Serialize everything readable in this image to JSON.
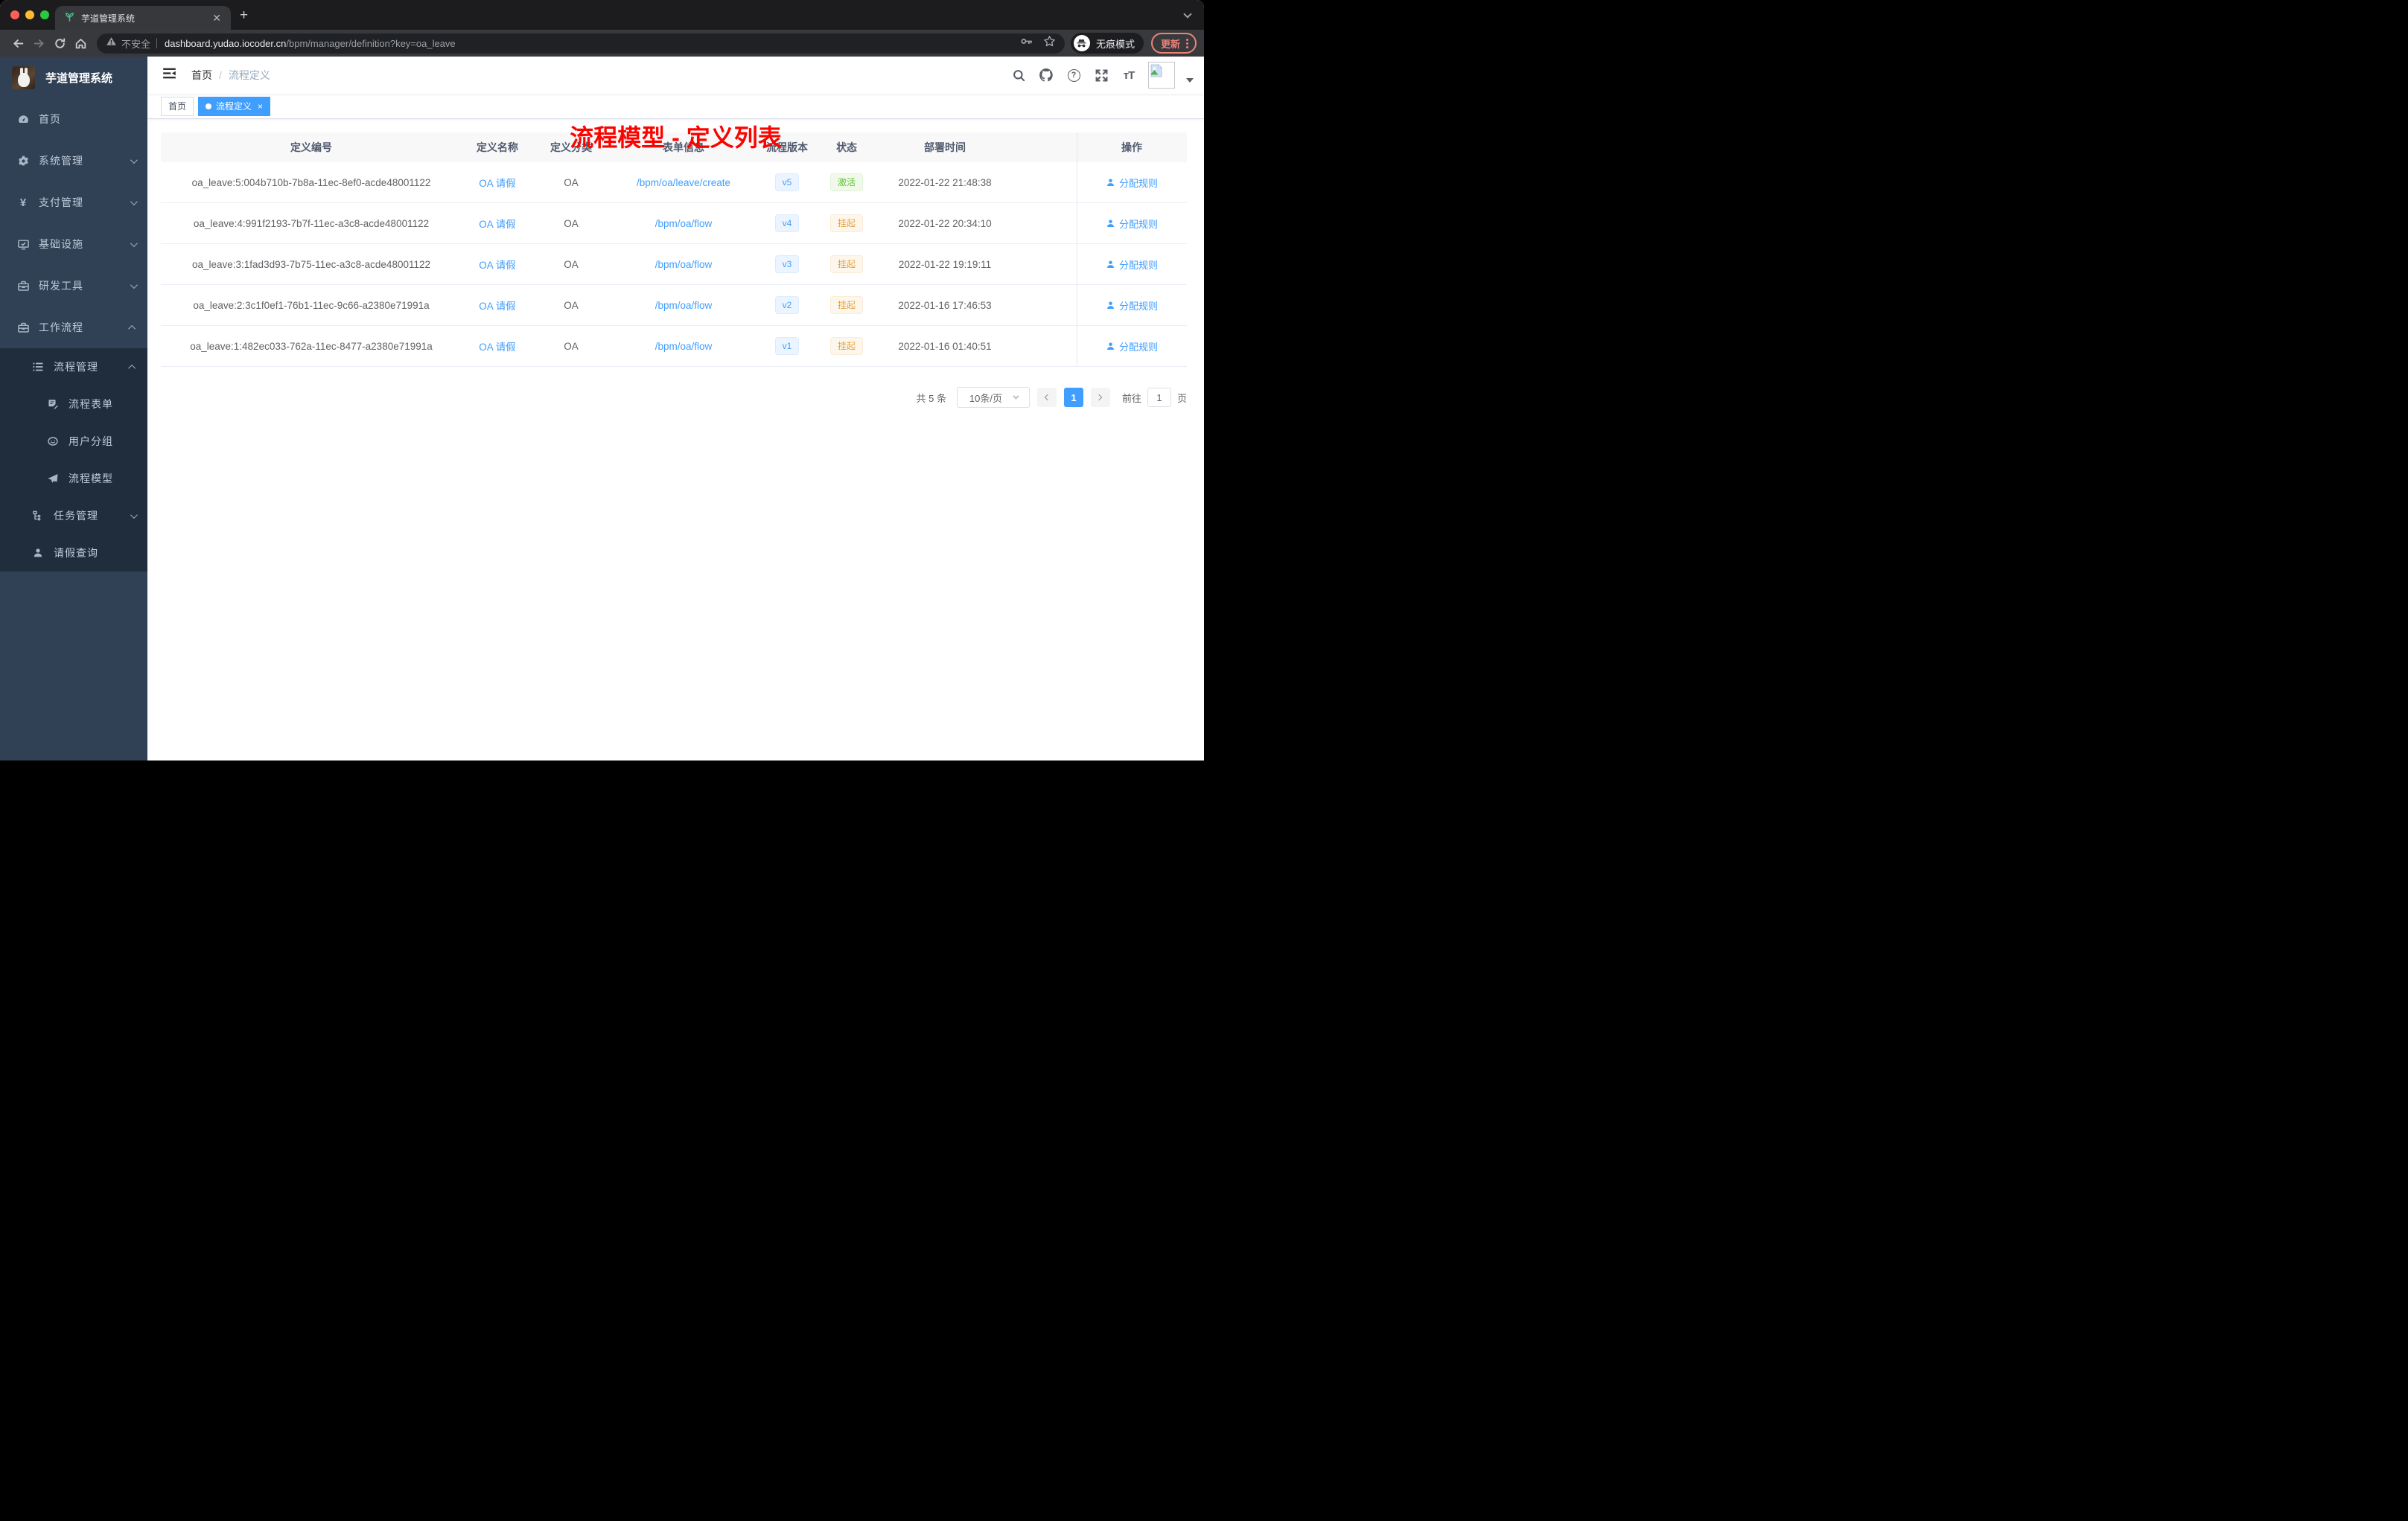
{
  "colors": {
    "accent": "#409eff",
    "success": "#67c23a",
    "warning": "#e6a23c",
    "annotation_red": "#fb0400",
    "sidebar_bg": "#304156",
    "submenu_bg": "#1f2d3d"
  },
  "browser": {
    "tab_title": "芋道管理系统",
    "security_label": "不安全",
    "url_host": "dashboard.yudao.iocoder.cn",
    "url_path": "/bpm/manager/definition?key=oa_leave",
    "incognito_label": "无痕模式",
    "update_label": "更新"
  },
  "sidebar": {
    "app_title": "芋道管理系统",
    "items": [
      {
        "label": "首页"
      },
      {
        "label": "系统管理"
      },
      {
        "label": "支付管理"
      },
      {
        "label": "基础设施"
      },
      {
        "label": "研发工具"
      },
      {
        "label": "工作流程"
      },
      {
        "label": "流程管理"
      },
      {
        "label": "流程表单"
      },
      {
        "label": "用户分组"
      },
      {
        "label": "流程模型"
      },
      {
        "label": "任务管理"
      },
      {
        "label": "请假查询"
      }
    ]
  },
  "navbar": {
    "breadcrumb": {
      "home": "首页",
      "current": "流程定义"
    },
    "annotation": "流程模型 - 定义列表"
  },
  "tags": [
    {
      "label": "首页"
    },
    {
      "label": "流程定义"
    }
  ],
  "table": {
    "columns": [
      "定义编号",
      "定义名称",
      "定义分类",
      "表单信息",
      "流程版本",
      "状态",
      "部署时间",
      "操作"
    ],
    "rows": [
      {
        "id": "oa_leave:5:004b710b-7b8a-11ec-8ef0-acde48001122",
        "name": "OA 请假",
        "category": "OA",
        "form": "/bpm/oa/leave/create",
        "version": "v5",
        "status": "激活",
        "status_type": "active",
        "time": "2022-01-22 21:48:38",
        "action": "分配规则"
      },
      {
        "id": "oa_leave:4:991f2193-7b7f-11ec-a3c8-acde48001122",
        "name": "OA 请假",
        "category": "OA",
        "form": "/bpm/oa/flow",
        "version": "v4",
        "status": "挂起",
        "status_type": "suspend",
        "time": "2022-01-22 20:34:10",
        "action": "分配规则"
      },
      {
        "id": "oa_leave:3:1fad3d93-7b75-11ec-a3c8-acde48001122",
        "name": "OA 请假",
        "category": "OA",
        "form": "/bpm/oa/flow",
        "version": "v3",
        "status": "挂起",
        "status_type": "suspend",
        "time": "2022-01-22 19:19:11",
        "action": "分配规则"
      },
      {
        "id": "oa_leave:2:3c1f0ef1-76b1-11ec-9c66-a2380e71991a",
        "name": "OA 请假",
        "category": "OA",
        "form": "/bpm/oa/flow",
        "version": "v2",
        "status": "挂起",
        "status_type": "suspend",
        "time": "2022-01-16 17:46:53",
        "action": "分配规则"
      },
      {
        "id": "oa_leave:1:482ec033-762a-11ec-8477-a2380e71991a",
        "name": "OA 请假",
        "category": "OA",
        "form": "/bpm/oa/flow",
        "version": "v1",
        "status": "挂起",
        "status_type": "suspend",
        "time": "2022-01-16 01:40:51",
        "action": "分配规则"
      }
    ]
  },
  "pagination": {
    "total": "共 5 条",
    "page_size": "10条/页",
    "current_page": "1",
    "goto_label": "前往",
    "goto_value": "1",
    "unit_label": "页"
  }
}
